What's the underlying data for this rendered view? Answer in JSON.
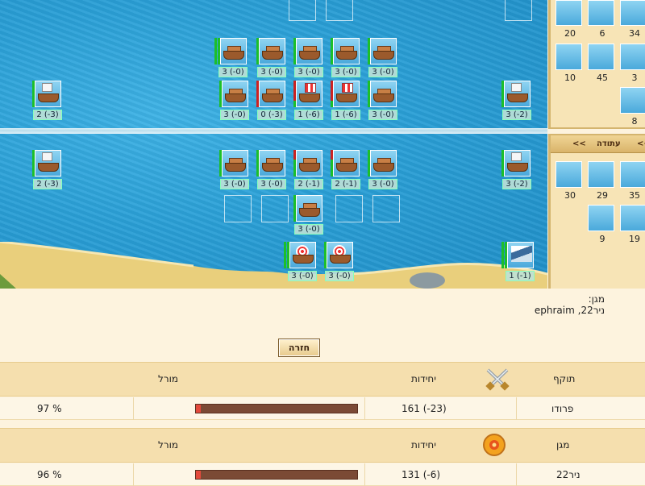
{
  "field": {
    "upper_left_unit": {
      "count": "2 (-3)"
    },
    "upper_right_unit": {
      "count": "3 (-2)"
    },
    "upper_row1": [
      "3 (-0)",
      "3 (-0)",
      "3 (-0)",
      "3 (-0)",
      "3 (-0)"
    ],
    "upper_row2": [
      "3 (-0)",
      "0 (-3)",
      "1 (-6)",
      "1 (-6)",
      "3 (-0)"
    ],
    "lower_left_unit": {
      "count": "2 (-3)"
    },
    "lower_right_unit": {
      "count": "3 (-2)"
    },
    "lower_row1": [
      "3 (-0)",
      "3 (-0)",
      "2 (-1)",
      "2 (-1)",
      "3 (-0)"
    ],
    "lower_row2_center": {
      "count": "3 (-0)"
    },
    "lower_row3": [
      "3 (-0)",
      "3 (-0)"
    ],
    "lower_row3_right": {
      "count": "1 (-1)"
    }
  },
  "panel_top": {
    "row1": [
      "20",
      "6",
      "34"
    ],
    "row2": [
      "10",
      "45",
      "3"
    ],
    "row3": [
      "8"
    ]
  },
  "panel_bottom": {
    "tab_left": "<<",
    "tab_center": "עתודה",
    "tab_right": "<<",
    "row1": [
      "30",
      "29",
      "35"
    ],
    "row2": [
      "9",
      "19"
    ]
  },
  "defender": {
    "label": "מגן:",
    "names": "ניר22, ephraim"
  },
  "back_button": "חזרה",
  "attacker_table": {
    "role": "תוקף",
    "units_header": "יחידות",
    "morale_header": "מורל",
    "player": "פרודו",
    "units": "161 (-23)",
    "morale": "97 %",
    "morale_value": 97
  },
  "defender_table": {
    "role": "מגן",
    "units_header": "יחידות",
    "morale_header": "מורל",
    "player": "ניר22",
    "units": "131 (-6)",
    "morale": "96 %",
    "morale_value": 96
  }
}
